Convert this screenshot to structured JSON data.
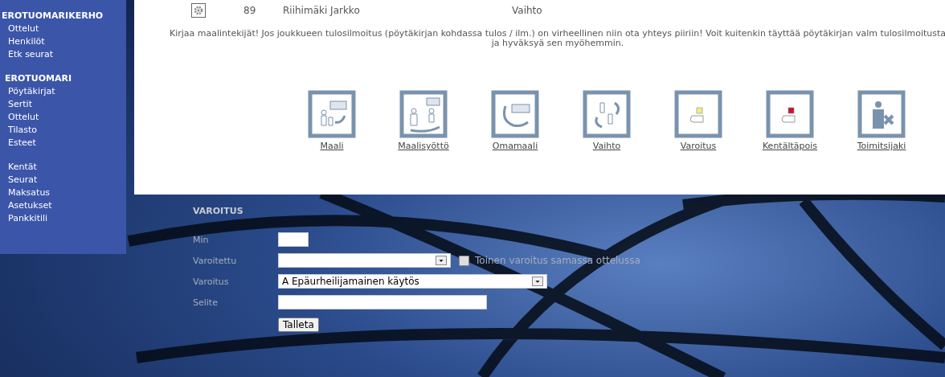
{
  "top_row": {
    "number": "89",
    "name": "Riihimäki Jarkko",
    "event": "Vaihto"
  },
  "notice": "Kirjaa maalintekijät! Jos joukkueen tulosilmoitus (pöytäkirjan kohdassa tulos / ilm.) on virheellinen niin ota yhteys piiriin! Voit kuitenkin täyttää pöytäkirjan valm tulosilmoitusta ja hyväksyä sen myöhemmin.",
  "sidebar": {
    "sections": [
      {
        "heading": "EROTUOMARIKERHO",
        "items": [
          "Ottelut",
          "Henkilöt",
          "Etk seurat"
        ]
      },
      {
        "heading": "EROTUOMARI",
        "items": [
          "Pöytäkirjat",
          "Sertit",
          "Ottelut",
          "Tilasto",
          "Esteet"
        ]
      },
      {
        "items": [
          "Kentät",
          "Seurat",
          "Maksatus",
          "Asetukset",
          "Pankkitili"
        ]
      }
    ]
  },
  "actions": [
    {
      "kind": "goal",
      "label": "Maali"
    },
    {
      "kind": "assist",
      "label": "Maalisyöttö"
    },
    {
      "kind": "own_goal",
      "label": "Omamaali"
    },
    {
      "kind": "substitution",
      "label": "Vaihto"
    },
    {
      "kind": "warning",
      "label": "Varoitus"
    },
    {
      "kind": "ejection",
      "label": "Kentältäpois"
    },
    {
      "kind": "official",
      "label": "Toimitsijaki"
    }
  ],
  "form": {
    "title": "VAROITUS",
    "fields": [
      {
        "kind": "short_text",
        "label": "Min"
      },
      {
        "kind": "select",
        "label": "Varoitettu",
        "checkbox": {
          "label": "Toinen varoitus samassa ottelussa",
          "checked": false
        }
      },
      {
        "kind": "wide_select",
        "label": "Varoitus",
        "value": "A Epäurheilijamainen käytös"
      },
      {
        "kind": "text",
        "label": "Selite"
      }
    ],
    "submit": "Talleta"
  }
}
